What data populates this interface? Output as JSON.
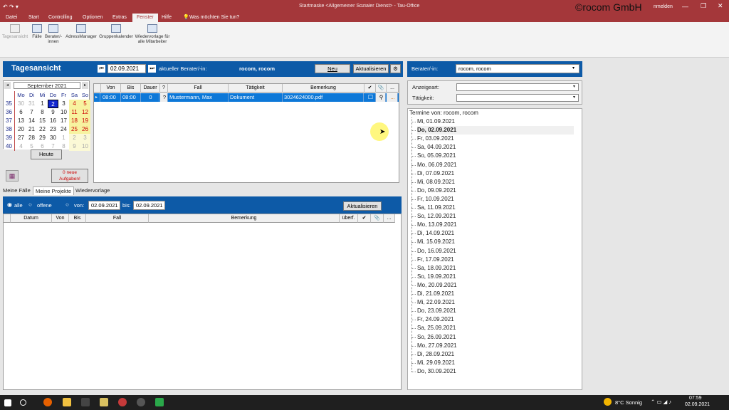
{
  "window": {
    "title": "Startmaske <Allgemeiner Sozialer Dienst> - Tau-Office",
    "watermark": "©rocom GmbH",
    "account": "nmelden"
  },
  "ribbon_tabs": [
    "Datei",
    "Start",
    "Controlling",
    "Optionen",
    "Extras",
    "Fenster",
    "Hilfe"
  ],
  "ribbon_search": "Was möchten Sie tun?",
  "ribbon_buttons": [
    "Tagesansicht",
    "Fälle",
    "Berater/-\ninnen",
    "AdressManager",
    "Gruppenkalender",
    "Wiedervorlage für\nalle Mitarbeiter"
  ],
  "tagesansicht": {
    "title": "Tagesansicht",
    "date": "02.09.2021",
    "berater_label": "aktueller Berater/-in:",
    "berater_value": "rocom, rocom",
    "btn_neu": "Neu",
    "btn_aktualisieren": "Aktualisieren"
  },
  "calendar": {
    "month_label": "September 2021",
    "weekdays": [
      "Mo",
      "Di",
      "Mi",
      "Do",
      "Fr",
      "Sa",
      "So"
    ],
    "weeks": [
      {
        "kw": "35",
        "days": [
          "30",
          "31",
          "1",
          "2",
          "3",
          "4",
          "5"
        ]
      },
      {
        "kw": "36",
        "days": [
          "6",
          "7",
          "8",
          "9",
          "10",
          "11",
          "12"
        ]
      },
      {
        "kw": "37",
        "days": [
          "13",
          "14",
          "15",
          "16",
          "17",
          "18",
          "19"
        ]
      },
      {
        "kw": "38",
        "days": [
          "20",
          "21",
          "22",
          "23",
          "24",
          "25",
          "26"
        ]
      },
      {
        "kw": "39",
        "days": [
          "27",
          "28",
          "29",
          "30",
          "1",
          "2",
          "3"
        ]
      },
      {
        "kw": "40",
        "days": [
          "4",
          "5",
          "6",
          "7",
          "8",
          "9",
          "10"
        ]
      }
    ],
    "today_btn": "Heute"
  },
  "aufgaben_btn": "0 neue\nAufgaben!",
  "appt_table": {
    "headers": [
      "Von",
      "Bis",
      "Dauer",
      "?",
      "Fall",
      "Tätigkeit",
      "Bemerkung",
      "✔",
      "📎",
      "..."
    ],
    "row": {
      "von": "08:00",
      "bis": "08:00",
      "dauer": "0",
      "q": "?",
      "fall": "Mustermann, Max",
      "taetigkeit": "Dokument",
      "bemerkung": "3024624000.pdf",
      "more": "..."
    }
  },
  "lower_tabs": [
    "Meine Fälle",
    "Meine Projekte",
    "Wiedervorlage"
  ],
  "filter": {
    "alle": "alle",
    "offene": "offene",
    "von": "von:",
    "von_date": "02.09.2021",
    "bis": "bis:",
    "bis_date": "02.09.2021",
    "btn": "Aktualisieren"
  },
  "proj_table": {
    "headers": [
      "Datum",
      "Von",
      "Bis",
      "Fall",
      "Bemerkung",
      "überf.",
      "✔",
      "📎",
      "..."
    ]
  },
  "right": {
    "berater_label": "Berater/-in:",
    "berater_value": "rocom, rocom",
    "anzeigeart": "Anzeigeart:",
    "taetigkeit": "Tätigkeit:",
    "tree_root": "Termine von: rocom, rocom",
    "dates": [
      "Mi, 01.09.2021",
      "Do, 02.09.2021",
      "Fr, 03.09.2021",
      "Sa, 04.09.2021",
      "So, 05.09.2021",
      "Mo, 06.09.2021",
      "Di, 07.09.2021",
      "Mi, 08.09.2021",
      "Do, 09.09.2021",
      "Fr, 10.09.2021",
      "Sa, 11.09.2021",
      "So, 12.09.2021",
      "Mo, 13.09.2021",
      "Di, 14.09.2021",
      "Mi, 15.09.2021",
      "Do, 16.09.2021",
      "Fr, 17.09.2021",
      "Sa, 18.09.2021",
      "So, 19.09.2021",
      "Mo, 20.09.2021",
      "Di, 21.09.2021",
      "Mi, 22.09.2021",
      "Do, 23.09.2021",
      "Fr, 24.09.2021",
      "Sa, 25.09.2021",
      "So, 26.09.2021",
      "Mo, 27.09.2021",
      "Di, 28.09.2021",
      "Mi, 29.09.2021",
      "Do, 30.09.2021"
    ]
  },
  "taskbar": {
    "weather": "8°C Sonnig",
    "time": "07:59",
    "date": "02.09.2021"
  },
  "colors": {
    "accent": "#a4373a",
    "blue": "#0d5aa7"
  }
}
